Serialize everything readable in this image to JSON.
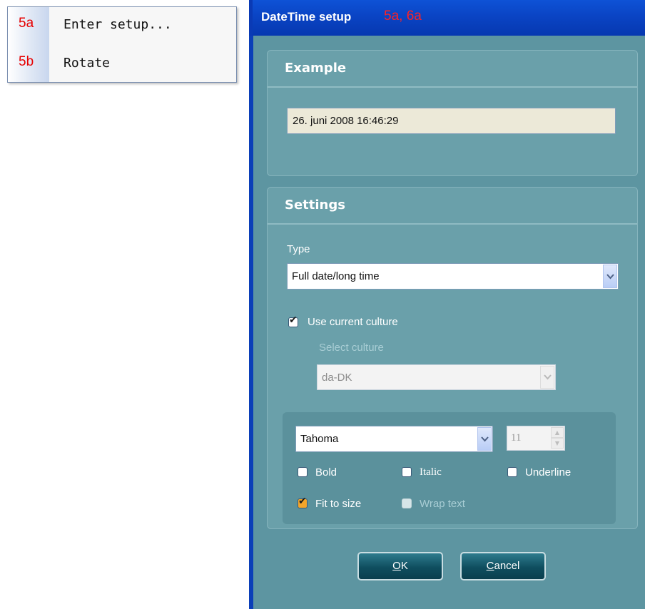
{
  "context_menu": {
    "items": [
      {
        "number": "5a",
        "label": "Enter setup..."
      },
      {
        "number": "5b",
        "label": "Rotate"
      }
    ]
  },
  "dialog": {
    "title": "DateTime setup",
    "annotation": "5a, 6a",
    "example": {
      "heading": "Example",
      "value": "26. juni 2008 16:46:29"
    },
    "settings": {
      "heading": "Settings",
      "type_label": "Type",
      "type_value": "Full date/long time",
      "use_current_culture_label": "Use current culture",
      "use_current_culture_checked": true,
      "select_culture_label": "Select culture",
      "culture_value": "da-DK",
      "font_value": "Tahoma",
      "font_size": "11",
      "bold_label": "Bold",
      "italic_label": "Italic",
      "underline_label": "Underline",
      "fit_to_size_label": "Fit to size",
      "fit_to_size_checked": true,
      "wrap_text_label": "Wrap text"
    },
    "buttons": {
      "ok_first": "O",
      "ok_rest": "K",
      "cancel_first": "C",
      "cancel_rest": "ancel"
    },
    "colors": {
      "titlebar": "#0a44c4",
      "dialog_bg": "#5d95a1",
      "annotation": "#ff2222"
    }
  }
}
